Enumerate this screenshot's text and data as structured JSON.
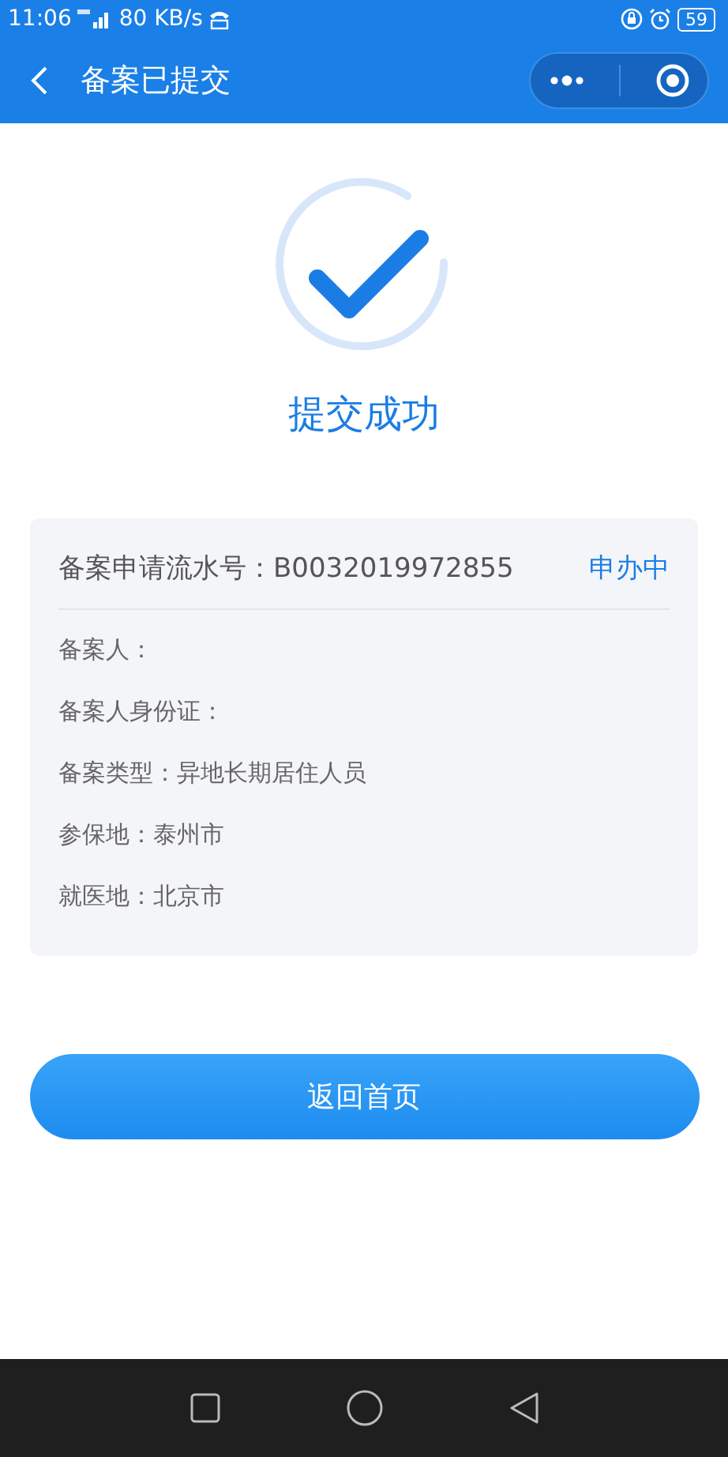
{
  "status_bar": {
    "time": "11:06",
    "network_speed": "80 KB/s",
    "battery": "59"
  },
  "nav_bar": {
    "title": "备案已提交"
  },
  "result": {
    "title": "提交成功"
  },
  "card": {
    "serial": "备案申请流水号：B0032019972855",
    "status": "申办中",
    "rows": [
      "备案人：",
      "备案人身份证：",
      "备案类型：异地长期居住人员",
      "参保地：泰州市",
      "就医地：北京市"
    ]
  },
  "button": "返回首页"
}
